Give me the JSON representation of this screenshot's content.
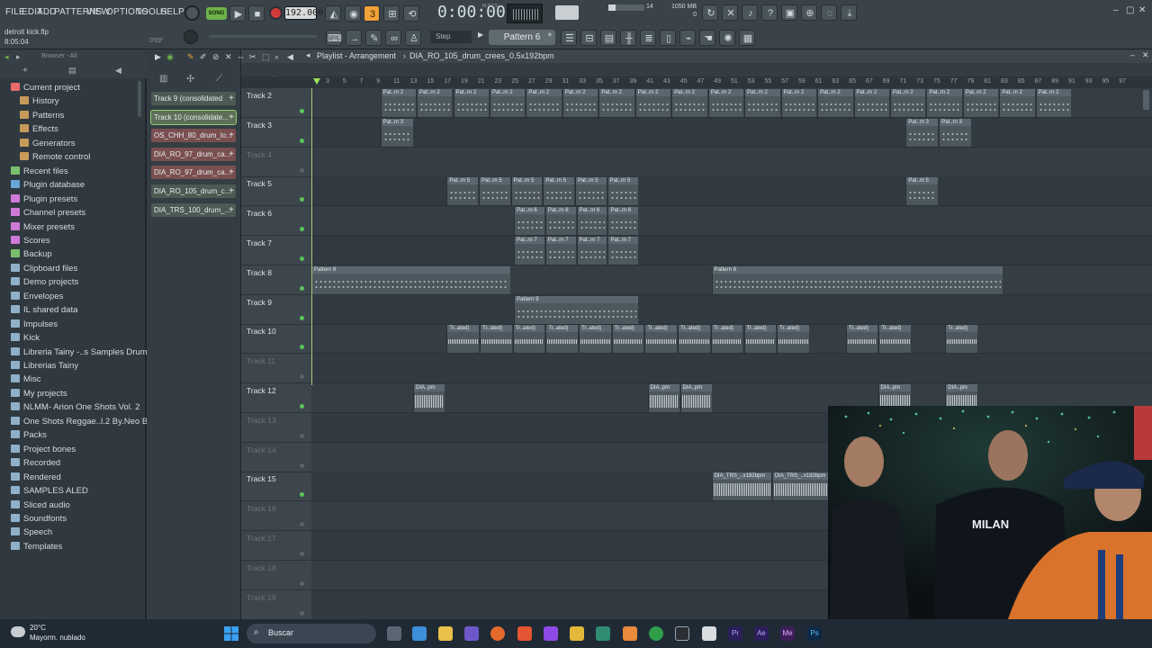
{
  "menu": [
    "FILE",
    "EDIT",
    "ADD",
    "PATTERNS",
    "VIEW",
    "OPTIONS",
    "TOOLS",
    "HELP"
  ],
  "transport": {
    "song_mode": "SONG",
    "tempo": "192.000",
    "time": "0:00:00",
    "time_label": "M:S:CS"
  },
  "status": {
    "cpu": "14",
    "memory": "1050 MB",
    "memory_sub": "0"
  },
  "file": {
    "name": "detroit kick.flp",
    "elapsed": "8:05:04",
    "hint_time": "0'09\""
  },
  "toolbar2": {
    "snap": "Step",
    "pattern": "Pattern 6"
  },
  "browser": {
    "title": "Browser - All",
    "items": [
      {
        "label": "Current project",
        "color": "#e86b6b",
        "indent": 0
      },
      {
        "label": "History",
        "color": "#c79a5a",
        "indent": 1
      },
      {
        "label": "Patterns",
        "color": "#c79a5a",
        "indent": 1
      },
      {
        "label": "Effects",
        "color": "#c79a5a",
        "indent": 1
      },
      {
        "label": "Generators",
        "color": "#c79a5a",
        "indent": 1
      },
      {
        "label": "Remote control",
        "color": "#c79a5a",
        "indent": 1
      },
      {
        "label": "Recent files",
        "color": "#7ac06c",
        "indent": 0
      },
      {
        "label": "Plugin database",
        "color": "#6aa5d8",
        "indent": 0
      },
      {
        "label": "Plugin presets",
        "color": "#d07ad8",
        "indent": 0
      },
      {
        "label": "Channel presets",
        "color": "#d07ad8",
        "indent": 0
      },
      {
        "label": "Mixer presets",
        "color": "#d07ad8",
        "indent": 0
      },
      {
        "label": "Scores",
        "color": "#d07ad8",
        "indent": 0
      },
      {
        "label": "Backup",
        "color": "#7ac06c",
        "indent": 0
      },
      {
        "label": "Clipboard files",
        "color": "#8fb0c8",
        "indent": 0
      },
      {
        "label": "Demo projects",
        "color": "#8fb0c8",
        "indent": 0
      },
      {
        "label": "Envelopes",
        "color": "#8fb0c8",
        "indent": 0
      },
      {
        "label": "IL shared data",
        "color": "#8fb0c8",
        "indent": 0
      },
      {
        "label": "Impulses",
        "color": "#8fb0c8",
        "indent": 0
      },
      {
        "label": "Kick",
        "color": "#8fb0c8",
        "indent": 0
      },
      {
        "label": "Libreria Tainy -..s Samples Drum Kit",
        "color": "#8fb0c8",
        "indent": 0
      },
      {
        "label": "Librerias Tainy",
        "color": "#8fb0c8",
        "indent": 0
      },
      {
        "label": "Misc",
        "color": "#8fb0c8",
        "indent": 0
      },
      {
        "label": "My projects",
        "color": "#8fb0c8",
        "indent": 0
      },
      {
        "label": "NLMM- Arion One Shots Vol. 2",
        "color": "#8fb0c8",
        "indent": 0
      },
      {
        "label": "One Shots Reggae..l.2 By.Neo Beats",
        "color": "#8fb0c8",
        "indent": 0
      },
      {
        "label": "Packs",
        "color": "#8fb0c8",
        "indent": 0
      },
      {
        "label": "Project bones",
        "color": "#8fb0c8",
        "indent": 0
      },
      {
        "label": "Recorded",
        "color": "#8fb0c8",
        "indent": 0
      },
      {
        "label": "Rendered",
        "color": "#8fb0c8",
        "indent": 0
      },
      {
        "label": "SAMPLES ALED",
        "color": "#8fb0c8",
        "indent": 0
      },
      {
        "label": "Sliced audio",
        "color": "#8fb0c8",
        "indent": 0
      },
      {
        "label": "Soundfonts",
        "color": "#8fb0c8",
        "indent": 0
      },
      {
        "label": "Speech",
        "color": "#8fb0c8",
        "indent": 0
      },
      {
        "label": "Templates",
        "color": "#8fb0c8",
        "indent": 0
      }
    ]
  },
  "channels": [
    {
      "label": "Track 9 (consolidated",
      "color": "#4b5a52"
    },
    {
      "label": "Track 10 (consolidate...",
      "color": "#5e6f58"
    },
    {
      "label": "OS_CHH_80_drum_lo...",
      "color": "#7a4f4f"
    },
    {
      "label": "DIA_RO_97_drum_ca...",
      "color": "#7a4f4f"
    },
    {
      "label": "DIA_RO_97_drum_ca...",
      "color": "#7a4f4f"
    },
    {
      "label": "DIA_RO_105_drum_c...",
      "color": "#4b5a52"
    },
    {
      "label": "DIA_TRS_100_drum_...",
      "color": "#4b5a52"
    }
  ],
  "playlist": {
    "title": "Playlist - Arrangement",
    "subtitle": "DIA_RO_105_drum_crees_0.5x192bpm",
    "ruler": [
      "3",
      "5",
      "7",
      "9",
      "11",
      "13",
      "15",
      "17",
      "19",
      "21",
      "23",
      "25",
      "27",
      "29",
      "31",
      "33",
      "35",
      "37",
      "39",
      "41",
      "43",
      "45",
      "47",
      "49",
      "51",
      "53",
      "55",
      "57",
      "59",
      "61",
      "63",
      "65",
      "67",
      "69",
      "71",
      "73",
      "75",
      "77",
      "79",
      "81",
      "83",
      "85",
      "87",
      "89",
      "91",
      "93",
      "95",
      "97"
    ],
    "tracks": [
      {
        "label": "Track 2",
        "active": true
      },
      {
        "label": "Track 3",
        "active": true
      },
      {
        "label": "Track 4",
        "active": false
      },
      {
        "label": "Track 5",
        "active": true
      },
      {
        "label": "Track 6",
        "active": true
      },
      {
        "label": "Track 7",
        "active": true
      },
      {
        "label": "Track 8",
        "active": true
      },
      {
        "label": "Track 9",
        "active": true
      },
      {
        "label": "Track 10",
        "active": true
      },
      {
        "label": "Track 11",
        "active": false
      },
      {
        "label": "Track 12",
        "active": true
      },
      {
        "label": "Track 13",
        "active": false
      },
      {
        "label": "Track 14",
        "active": false
      },
      {
        "label": "Track 15",
        "active": true
      },
      {
        "label": "Track 16",
        "active": false
      },
      {
        "label": "Track 17",
        "active": false
      },
      {
        "label": "Track 18",
        "active": false
      },
      {
        "label": "Track 19",
        "active": false
      }
    ],
    "clips": [
      {
        "track": 0,
        "from": 0.082,
        "to": 0.905,
        "label": "Pat..rn 2",
        "kind": "dots",
        "repeat": 19
      },
      {
        "track": 1,
        "from": 0.082,
        "to": 0.122,
        "label": "Pat..rn 3",
        "kind": "dots",
        "repeat": 1
      },
      {
        "track": 1,
        "from": 0.707,
        "to": 0.786,
        "label": "Pat..rn 3",
        "kind": "dots",
        "repeat": 2
      },
      {
        "track": 3,
        "from": 0.161,
        "to": 0.39,
        "label": "Pat..rn 5",
        "kind": "dots",
        "repeat": 6
      },
      {
        "track": 3,
        "from": 0.707,
        "to": 0.746,
        "label": "Pat..rn 5",
        "kind": "dots",
        "repeat": 1
      },
      {
        "track": 4,
        "from": 0.241,
        "to": 0.39,
        "label": "Pat..rn 6",
        "kind": "dots",
        "repeat": 4
      },
      {
        "track": 5,
        "from": 0.241,
        "to": 0.39,
        "label": "Pat..rn 7",
        "kind": "dots",
        "repeat": 4
      },
      {
        "track": 6,
        "from": 0.0,
        "to": 0.238,
        "label": "Pattern 8",
        "kind": "dots",
        "repeat": 1
      },
      {
        "track": 6,
        "from": 0.476,
        "to": 0.823,
        "label": "Pattern 8",
        "kind": "dots",
        "repeat": 1
      },
      {
        "track": 7,
        "from": 0.241,
        "to": 0.39,
        "label": "Pattern 9",
        "kind": "dots",
        "repeat": 1
      },
      {
        "track": 8,
        "from": 0.161,
        "to": 0.593,
        "label": "Tr..ated)",
        "kind": "thin",
        "repeat": 11
      },
      {
        "track": 8,
        "from": 0.636,
        "to": 0.714,
        "label": "Tr..ated)",
        "kind": "thin",
        "repeat": 2
      },
      {
        "track": 8,
        "from": 0.754,
        "to": 0.793,
        "label": "Tr..ated)",
        "kind": "thin",
        "repeat": 1
      },
      {
        "track": 10,
        "from": 0.121,
        "to": 0.16,
        "label": "DIA..pm",
        "kind": "wave",
        "repeat": 1
      },
      {
        "track": 10,
        "from": 0.4,
        "to": 0.477,
        "label": "DIA..pm",
        "kind": "wave",
        "repeat": 2
      },
      {
        "track": 10,
        "from": 0.674,
        "to": 0.714,
        "label": "DIA..pm",
        "kind": "wave",
        "repeat": 1
      },
      {
        "track": 10,
        "from": 0.754,
        "to": 0.793,
        "label": "DIA..pm",
        "kind": "wave",
        "repeat": 1
      },
      {
        "track": 13,
        "from": 0.476,
        "to": 0.62,
        "label": "DIA_TRS_..x192bpm",
        "kind": "wave",
        "repeat": 2
      }
    ]
  },
  "taskbar": {
    "weather_temp": "20°C",
    "weather_desc": "Mayorm. nublado",
    "search": "Buscar"
  },
  "colors": {
    "accent_orange": "#f0a23a",
    "led_green": "#5cc55a",
    "record_red": "#d23b3b"
  }
}
